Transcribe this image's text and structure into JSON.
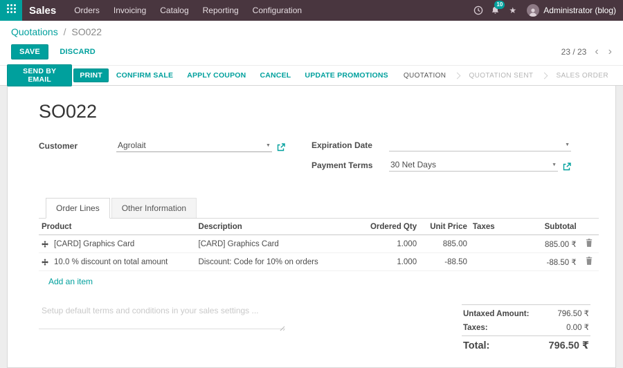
{
  "colors": {
    "accent": "#00a09d",
    "navbar_bg": "#49363f"
  },
  "icons": {
    "caret": "▼",
    "pager_prev": "‹",
    "pager_next": "›",
    "star": "★"
  },
  "navbar": {
    "app_title": "Sales",
    "menu_items": [
      "Orders",
      "Invoicing",
      "Catalog",
      "Reporting",
      "Configuration"
    ],
    "notification_count": "10",
    "user_name": "Administrator (blog)"
  },
  "breadcrumb": {
    "parent": "Quotations",
    "separator": "/",
    "current": "SO022"
  },
  "control_panel": {
    "save_label": "SAVE",
    "discard_label": "DISCARD",
    "pager_value": "23 / 23"
  },
  "action_bar": {
    "send_email_label": "SEND BY EMAIL",
    "print_label": "PRINT",
    "confirm_sale_label": "CONFIRM SALE",
    "apply_coupon_label": "APPLY COUPON",
    "cancel_label": "CANCEL",
    "update_promotions_label": "UPDATE PROMOTIONS",
    "statuses": [
      {
        "label": "QUOTATION",
        "active": true
      },
      {
        "label": "QUOTATION SENT",
        "active": false
      },
      {
        "label": "SALES ORDER",
        "active": false
      }
    ]
  },
  "form": {
    "title": "SO022",
    "customer": {
      "label": "Customer",
      "value": "Agrolait"
    },
    "expiration": {
      "label": "Expiration Date",
      "value": ""
    },
    "payment_terms": {
      "label": "Payment Terms",
      "value": "30 Net Days"
    },
    "tabs": [
      {
        "label": "Order Lines",
        "active": true
      },
      {
        "label": "Other Information",
        "active": false
      }
    ],
    "order_lines": {
      "columns": [
        "Product",
        "Description",
        "Ordered Qty",
        "Unit Price",
        "Taxes",
        "Subtotal"
      ],
      "rows": [
        {
          "product": "[CARD] Graphics Card",
          "description": "[CARD] Graphics Card",
          "ordered_qty": "1.000",
          "unit_price": "885.00",
          "taxes": "",
          "subtotal": "885.00 ₹"
        },
        {
          "product": "10.0 % discount on total amount",
          "description": "Discount: Code for 10% on orders",
          "ordered_qty": "1.000",
          "unit_price": "-88.50",
          "taxes": "",
          "subtotal": "-88.50 ₹"
        }
      ],
      "add_item_label": "Add an item"
    },
    "terms_placeholder": "Setup default terms and conditions in your sales settings ...",
    "totals": {
      "untaxed_label": "Untaxed Amount:",
      "untaxed_value": "796.50 ₹",
      "taxes_label": "Taxes:",
      "taxes_value": "0.00 ₹",
      "total_label": "Total:",
      "total_value": "796.50 ₹"
    }
  }
}
